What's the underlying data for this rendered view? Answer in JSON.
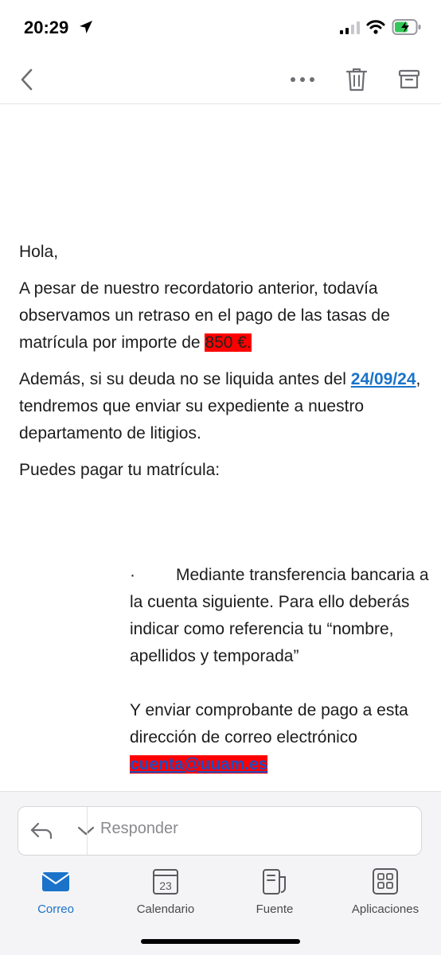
{
  "status": {
    "time": "20:29"
  },
  "colors": {
    "accent": "#1a73c9",
    "highlight": "#ff0000"
  },
  "toolbar": {
    "icons": [
      "back-chevron-icon",
      "more-icon",
      "trash-icon",
      "archive-icon"
    ]
  },
  "mail": {
    "greeting": "Hola,",
    "p1_before": "A pesar de nuestro recordatorio anterior, todavía observamos un retraso en el pago de las tasas de matrícula por importe de ",
    "p1_amount": "850 €.",
    "p2_before": "Además, si su deuda no se liquida antes del ",
    "p2_date": "24/09/24",
    "p2_after": ", tendremos que enviar su expediente a nuestro departamento de litigios.",
    "p3": "Puedes pagar tu matrícula:",
    "bullet_dot": "·",
    "bullet_text": "Mediante transferencia bancaria a la cuenta siguiente. Para ello deberás indicar como referencia tu “nombre, apellidos y temporada”",
    "send_text": "Y enviar comprobante de pago a esta dirección de correo electrónico",
    "email": "cuenta@uuam.es"
  },
  "reply": {
    "placeholder": "Responder"
  },
  "nav": {
    "items": [
      {
        "label": "Correo",
        "icon": "mail-icon",
        "active": true
      },
      {
        "label": "Calendario",
        "icon": "calendar-icon",
        "day": "23"
      },
      {
        "label": "Fuente",
        "icon": "feed-icon"
      },
      {
        "label": "Aplicaciones",
        "icon": "apps-icon"
      }
    ]
  }
}
